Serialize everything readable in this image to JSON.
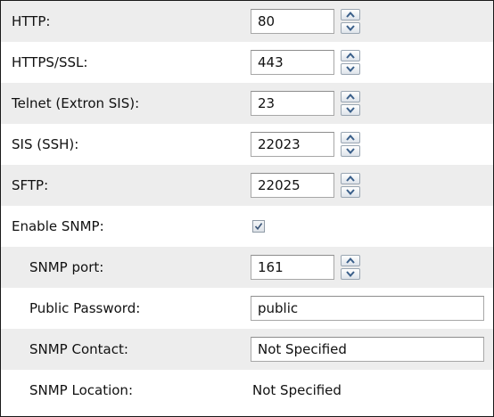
{
  "colors": {
    "row_shaded": "#ededed",
    "row_plain": "#ffffff",
    "spinner_arrow": "#3a5f8a",
    "checkmark": "#3b5578"
  },
  "fields": {
    "http": {
      "label": "HTTP:",
      "value": "80"
    },
    "https": {
      "label": "HTTPS/SSL:",
      "value": "443"
    },
    "telnet": {
      "label": "Telnet (Extron SIS):",
      "value": "23"
    },
    "sis_ssh": {
      "label": "SIS (SSH):",
      "value": "22023"
    },
    "sftp": {
      "label": "SFTP:",
      "value": "22025"
    },
    "enable_snmp": {
      "label": "Enable SNMP:",
      "checked": true
    },
    "snmp_port": {
      "label": "SNMP port:",
      "value": "161"
    },
    "public_password": {
      "label": "Public Password:",
      "value": "public"
    },
    "snmp_contact": {
      "label": "SNMP Contact:",
      "value": "Not Specified"
    },
    "snmp_location": {
      "label": "SNMP Location:",
      "value": "Not Specified"
    }
  },
  "icons": {
    "spin_up": "spinner-up-arrow-icon",
    "spin_down": "spinner-down-arrow-icon",
    "check": "checkmark-icon"
  }
}
